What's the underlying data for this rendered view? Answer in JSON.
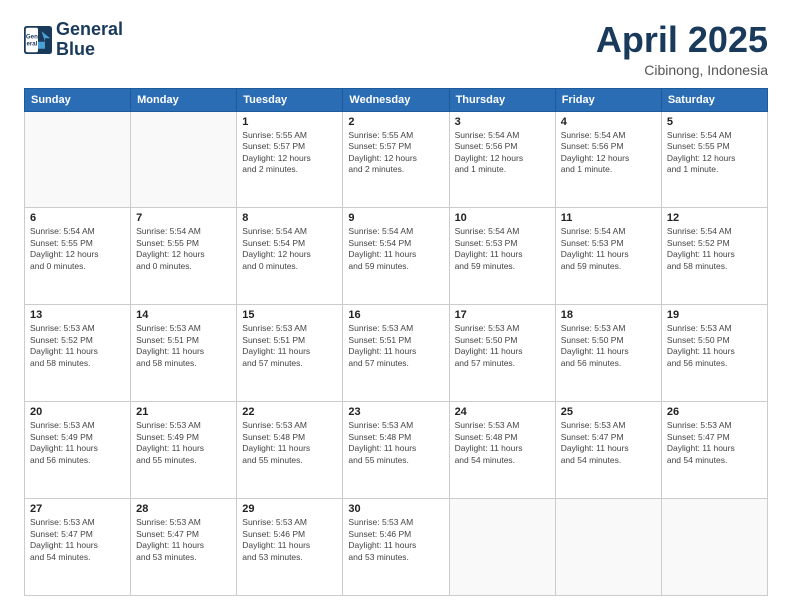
{
  "logo": {
    "line1": "General",
    "line2": "Blue"
  },
  "header": {
    "title": "April 2025",
    "subtitle": "Cibinong, Indonesia"
  },
  "weekdays": [
    "Sunday",
    "Monday",
    "Tuesday",
    "Wednesday",
    "Thursday",
    "Friday",
    "Saturday"
  ],
  "weeks": [
    [
      {
        "day": "",
        "detail": ""
      },
      {
        "day": "",
        "detail": ""
      },
      {
        "day": "1",
        "detail": "Sunrise: 5:55 AM\nSunset: 5:57 PM\nDaylight: 12 hours\nand 2 minutes."
      },
      {
        "day": "2",
        "detail": "Sunrise: 5:55 AM\nSunset: 5:57 PM\nDaylight: 12 hours\nand 2 minutes."
      },
      {
        "day": "3",
        "detail": "Sunrise: 5:54 AM\nSunset: 5:56 PM\nDaylight: 12 hours\nand 1 minute."
      },
      {
        "day": "4",
        "detail": "Sunrise: 5:54 AM\nSunset: 5:56 PM\nDaylight: 12 hours\nand 1 minute."
      },
      {
        "day": "5",
        "detail": "Sunrise: 5:54 AM\nSunset: 5:55 PM\nDaylight: 12 hours\nand 1 minute."
      }
    ],
    [
      {
        "day": "6",
        "detail": "Sunrise: 5:54 AM\nSunset: 5:55 PM\nDaylight: 12 hours\nand 0 minutes."
      },
      {
        "day": "7",
        "detail": "Sunrise: 5:54 AM\nSunset: 5:55 PM\nDaylight: 12 hours\nand 0 minutes."
      },
      {
        "day": "8",
        "detail": "Sunrise: 5:54 AM\nSunset: 5:54 PM\nDaylight: 12 hours\nand 0 minutes."
      },
      {
        "day": "9",
        "detail": "Sunrise: 5:54 AM\nSunset: 5:54 PM\nDaylight: 11 hours\nand 59 minutes."
      },
      {
        "day": "10",
        "detail": "Sunrise: 5:54 AM\nSunset: 5:53 PM\nDaylight: 11 hours\nand 59 minutes."
      },
      {
        "day": "11",
        "detail": "Sunrise: 5:54 AM\nSunset: 5:53 PM\nDaylight: 11 hours\nand 59 minutes."
      },
      {
        "day": "12",
        "detail": "Sunrise: 5:54 AM\nSunset: 5:52 PM\nDaylight: 11 hours\nand 58 minutes."
      }
    ],
    [
      {
        "day": "13",
        "detail": "Sunrise: 5:53 AM\nSunset: 5:52 PM\nDaylight: 11 hours\nand 58 minutes."
      },
      {
        "day": "14",
        "detail": "Sunrise: 5:53 AM\nSunset: 5:51 PM\nDaylight: 11 hours\nand 58 minutes."
      },
      {
        "day": "15",
        "detail": "Sunrise: 5:53 AM\nSunset: 5:51 PM\nDaylight: 11 hours\nand 57 minutes."
      },
      {
        "day": "16",
        "detail": "Sunrise: 5:53 AM\nSunset: 5:51 PM\nDaylight: 11 hours\nand 57 minutes."
      },
      {
        "day": "17",
        "detail": "Sunrise: 5:53 AM\nSunset: 5:50 PM\nDaylight: 11 hours\nand 57 minutes."
      },
      {
        "day": "18",
        "detail": "Sunrise: 5:53 AM\nSunset: 5:50 PM\nDaylight: 11 hours\nand 56 minutes."
      },
      {
        "day": "19",
        "detail": "Sunrise: 5:53 AM\nSunset: 5:50 PM\nDaylight: 11 hours\nand 56 minutes."
      }
    ],
    [
      {
        "day": "20",
        "detail": "Sunrise: 5:53 AM\nSunset: 5:49 PM\nDaylight: 11 hours\nand 56 minutes."
      },
      {
        "day": "21",
        "detail": "Sunrise: 5:53 AM\nSunset: 5:49 PM\nDaylight: 11 hours\nand 55 minutes."
      },
      {
        "day": "22",
        "detail": "Sunrise: 5:53 AM\nSunset: 5:48 PM\nDaylight: 11 hours\nand 55 minutes."
      },
      {
        "day": "23",
        "detail": "Sunrise: 5:53 AM\nSunset: 5:48 PM\nDaylight: 11 hours\nand 55 minutes."
      },
      {
        "day": "24",
        "detail": "Sunrise: 5:53 AM\nSunset: 5:48 PM\nDaylight: 11 hours\nand 54 minutes."
      },
      {
        "day": "25",
        "detail": "Sunrise: 5:53 AM\nSunset: 5:47 PM\nDaylight: 11 hours\nand 54 minutes."
      },
      {
        "day": "26",
        "detail": "Sunrise: 5:53 AM\nSunset: 5:47 PM\nDaylight: 11 hours\nand 54 minutes."
      }
    ],
    [
      {
        "day": "27",
        "detail": "Sunrise: 5:53 AM\nSunset: 5:47 PM\nDaylight: 11 hours\nand 54 minutes."
      },
      {
        "day": "28",
        "detail": "Sunrise: 5:53 AM\nSunset: 5:47 PM\nDaylight: 11 hours\nand 53 minutes."
      },
      {
        "day": "29",
        "detail": "Sunrise: 5:53 AM\nSunset: 5:46 PM\nDaylight: 11 hours\nand 53 minutes."
      },
      {
        "day": "30",
        "detail": "Sunrise: 5:53 AM\nSunset: 5:46 PM\nDaylight: 11 hours\nand 53 minutes."
      },
      {
        "day": "",
        "detail": ""
      },
      {
        "day": "",
        "detail": ""
      },
      {
        "day": "",
        "detail": ""
      }
    ]
  ]
}
